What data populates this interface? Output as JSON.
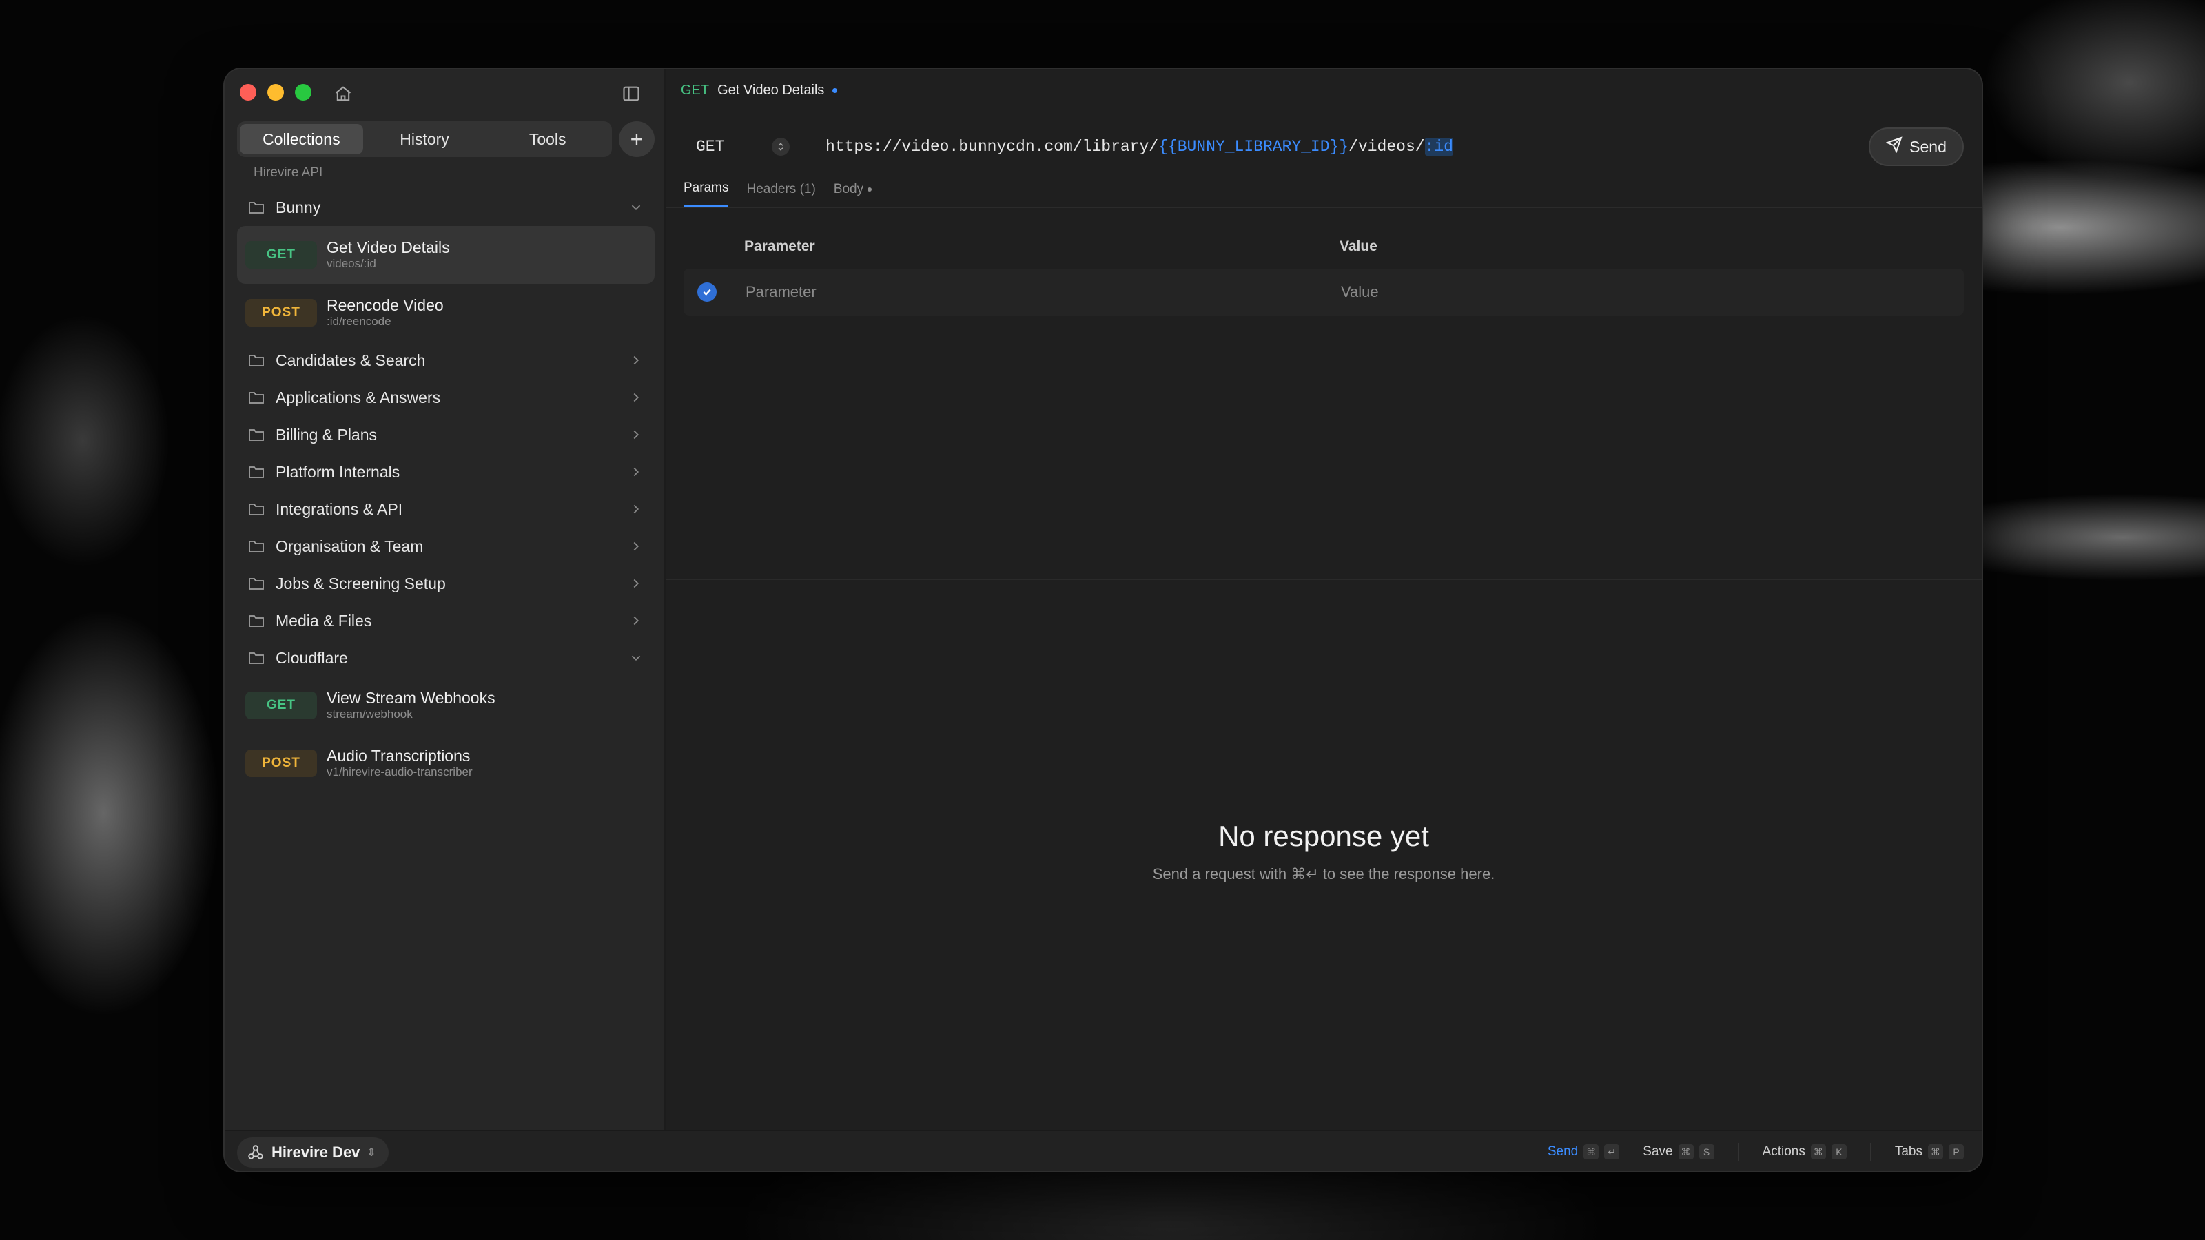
{
  "sidebar": {
    "segments": [
      "Collections",
      "History",
      "Tools"
    ],
    "group_label": "Hirevire API",
    "tree": [
      {
        "type": "folder",
        "name": "Bunny",
        "expanded": true
      },
      {
        "type": "request",
        "method": "GET",
        "title": "Get Video Details",
        "path": "videos/:id",
        "active": true
      },
      {
        "type": "request",
        "method": "POST",
        "title": "Reencode Video",
        "path": ":id/reencode"
      },
      {
        "type": "folder",
        "name": "Candidates & Search"
      },
      {
        "type": "folder",
        "name": "Applications & Answers"
      },
      {
        "type": "folder",
        "name": "Billing & Plans"
      },
      {
        "type": "folder",
        "name": "Platform Internals"
      },
      {
        "type": "folder",
        "name": "Integrations & API"
      },
      {
        "type": "folder",
        "name": "Organisation & Team"
      },
      {
        "type": "folder",
        "name": "Jobs & Screening Setup"
      },
      {
        "type": "folder",
        "name": "Media & Files"
      },
      {
        "type": "folder",
        "name": "Cloudflare",
        "expanded": true
      },
      {
        "type": "request",
        "method": "GET",
        "title": "View Stream Webhooks",
        "path": "stream/webhook"
      },
      {
        "type": "request",
        "method": "POST",
        "title": "Audio Transcriptions",
        "path": "v1/hirevire-audio-transcriber"
      }
    ]
  },
  "tab": {
    "method": "GET",
    "title": "Get Video Details"
  },
  "request": {
    "method": "GET",
    "url_parts": [
      "https://video.bunnycdn.com/library/",
      "{{BUNNY_LIBRARY_ID}}",
      "/videos/",
      ":id"
    ],
    "send_label": "Send",
    "tabs": [
      "Params",
      "Headers (1)",
      "Body"
    ]
  },
  "params": {
    "header_param": "Parameter",
    "header_value": "Value",
    "placeholder_param": "Parameter",
    "placeholder_value": "Value"
  },
  "response": {
    "title": "No response yet",
    "subtitle": "Send a request with ⌘↵ to see the response here."
  },
  "statusbar": {
    "environment": "Hirevire Dev",
    "shortcuts": [
      {
        "label": "Send",
        "keys": [
          "⌘",
          "↵"
        ]
      },
      {
        "label": "Save",
        "keys": [
          "⌘",
          "S"
        ]
      },
      {
        "label": "Actions",
        "keys": [
          "⌘",
          "K"
        ]
      },
      {
        "label": "Tabs",
        "keys": [
          "⌘",
          "P"
        ]
      }
    ]
  },
  "colors": {
    "accent": "#3b8cff",
    "get": "#47c484",
    "post": "#f0b53a"
  }
}
